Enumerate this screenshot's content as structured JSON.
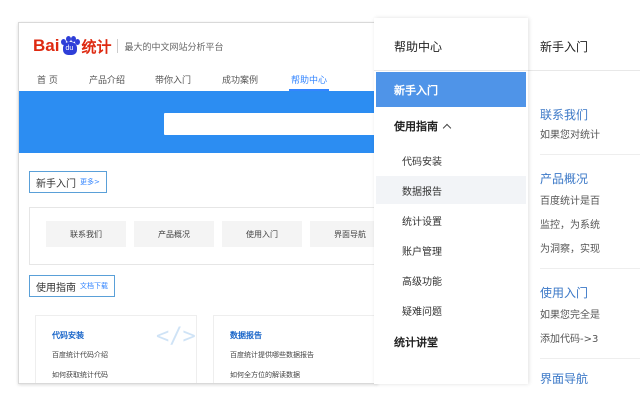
{
  "site": {
    "logo": {
      "bai": "Bai",
      "du": "du",
      "stat": "统计"
    },
    "slogan": "最大的中文网站分析平台",
    "nav": [
      "首 页",
      "产品介绍",
      "带你入门",
      "成功案例",
      "帮助中心"
    ],
    "active_nav": "帮助中心",
    "newbie_section": {
      "title": "新手入门",
      "more": "更多>"
    },
    "quick_links": [
      "联系我们",
      "产品概况",
      "使用入门",
      "界面导航"
    ],
    "guide_section": {
      "title": "使用指南",
      "more": "文档下载"
    },
    "cards": [
      {
        "title": "代码安装",
        "lines": [
          "百度统计代码介绍",
          "如何获取统计代码"
        ],
        "icon": "</>"
      },
      {
        "title": "数据报告",
        "lines": [
          "百度统计提供哪些数据报告",
          "如何全方位的解读数据"
        ],
        "icon": ""
      }
    ]
  },
  "help_center": {
    "title": "帮助中心",
    "active_item": "新手入门",
    "group_expanded": "使用指南",
    "sub_items": [
      "代码安装",
      "数据报告",
      "统计设置",
      "账户管理",
      "高级功能",
      "疑难问题"
    ],
    "hovered_item": "数据报告",
    "group_collapsed": "统计讲堂"
  },
  "content": {
    "title": "新手入门",
    "sections": [
      {
        "heading": "联系我们",
        "lines": [
          "如果您对统计"
        ]
      },
      {
        "heading": "产品概况",
        "lines": [
          "百度统计是百",
          "监控，为系统",
          "为洞察，实现"
        ]
      },
      {
        "heading": "使用入门",
        "lines": [
          "如果您完全是",
          "添加代码->3"
        ]
      },
      {
        "heading": "界面导航",
        "lines": []
      }
    ]
  }
}
